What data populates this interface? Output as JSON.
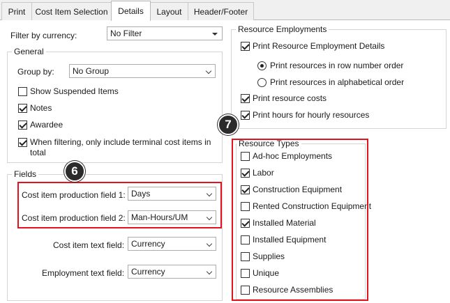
{
  "tabs": [
    {
      "label": "Print"
    },
    {
      "label": "Cost Item Selection"
    },
    {
      "label": "Details"
    },
    {
      "label": "Layout"
    },
    {
      "label": "Header/Footer"
    }
  ],
  "filter": {
    "label": "Filter by currency:",
    "value": "No Filter"
  },
  "general": {
    "title": "General",
    "group_by_label": "Group by:",
    "group_by_value": "No Group",
    "show_suspended": "Show Suspended Items",
    "notes": "Notes",
    "awardee": "Awardee",
    "terminal_line1": "When filtering, only include terminal cost items in",
    "terminal_line2": "total"
  },
  "fields": {
    "title": "Fields",
    "prod1_label": "Cost item production field 1:",
    "prod1_value": "Days",
    "prod2_label": "Cost item production field 2:",
    "prod2_value": "Man-Hours/UM",
    "text_label": "Cost item text field:",
    "text_value": "Currency",
    "emp_label": "Employment text field:",
    "emp_value": "Currency"
  },
  "resource_employments": {
    "title": "Resource Employments",
    "print_details": "Print Resource Employment Details",
    "row_order": "Print resources in row number order",
    "alpha_order": "Print resources in alphabetical order",
    "costs": "Print resource costs",
    "hours": "Print hours for hourly resources"
  },
  "resource_types": {
    "title": "Resource Types",
    "items": [
      {
        "label": "Ad-hoc Employments",
        "checked": false
      },
      {
        "label": "Labor",
        "checked": true
      },
      {
        "label": "Construction Equipment",
        "checked": true
      },
      {
        "label": "Rented Construction Equipment",
        "checked": false
      },
      {
        "label": "Installed Material",
        "checked": true
      },
      {
        "label": "Installed Equipment",
        "checked": false
      },
      {
        "label": "Supplies",
        "checked": false
      },
      {
        "label": "Unique",
        "checked": false
      },
      {
        "label": "Resource Assemblies",
        "checked": false
      }
    ]
  },
  "badges": {
    "six": "6",
    "seven": "7"
  },
  "colors": {
    "highlight": "#e3131d",
    "badge": "#2b2b2b"
  }
}
